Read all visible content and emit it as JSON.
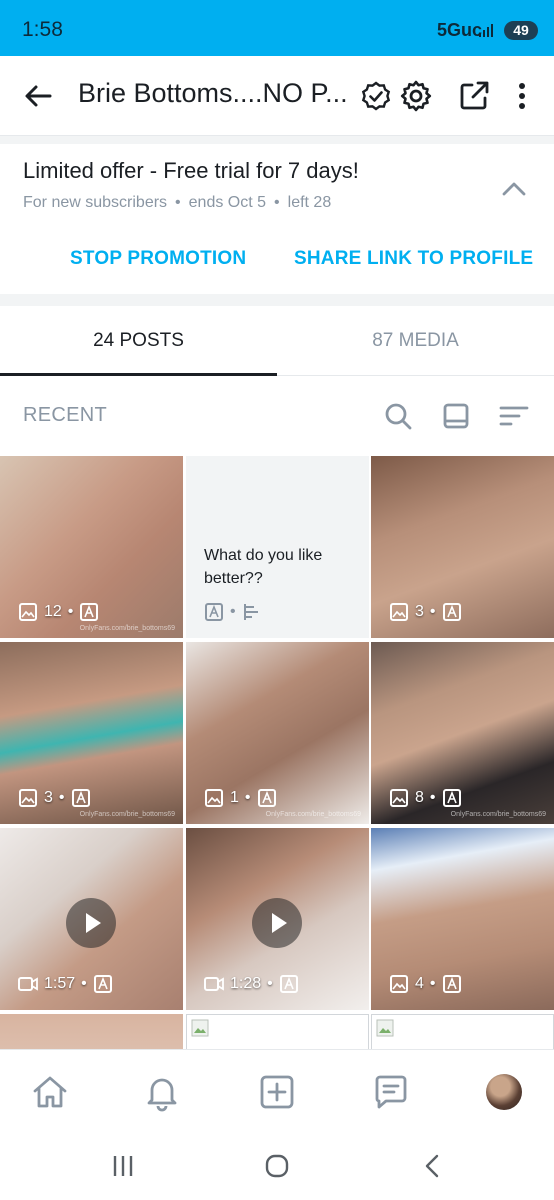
{
  "status": {
    "time": "1:58",
    "network": "5Guc",
    "battery": "49"
  },
  "header": {
    "title": "Brie Bottoms....NO P...",
    "icons": [
      "back-arrow-icon",
      "verified-badge-icon",
      "gear-icon",
      "share-icon",
      "more-vert-icon"
    ]
  },
  "promo": {
    "title": "Limited offer - Free trial for 7 days!",
    "audience": "For new subscribers",
    "ends": "ends Oct 5",
    "left": "left 28",
    "separator": "•",
    "stop_label": "STOP PROMOTION",
    "share_label": "SHARE LINK TO PROFILE"
  },
  "tabs": [
    {
      "label": "24 POSTS",
      "active": true
    },
    {
      "label": "87 MEDIA",
      "active": false
    }
  ],
  "filter": {
    "label": "RECENT",
    "icons": [
      "search-icon",
      "layout-icon",
      "sort-icon"
    ]
  },
  "grid": {
    "tiles": [
      {
        "kind": "photo",
        "count": "12"
      },
      {
        "kind": "text",
        "text": "What do you like better??"
      },
      {
        "kind": "photo",
        "count": "3"
      },
      {
        "kind": "photo",
        "count": "3"
      },
      {
        "kind": "photo",
        "count": "1"
      },
      {
        "kind": "photo",
        "count": "8"
      },
      {
        "kind": "video",
        "duration": "1:57"
      },
      {
        "kind": "video",
        "duration": "1:28"
      },
      {
        "kind": "photo",
        "count": "4"
      }
    ],
    "separator": "•",
    "watermark": "OnlyFans.com/brie_bottoms69"
  },
  "bottom_nav": [
    "home-icon",
    "notifications-icon",
    "add-post-icon",
    "messages-icon",
    "profile-avatar"
  ],
  "colors": {
    "accent": "#00aff0",
    "muted": "#8a96a3",
    "text": "#1b1f24"
  }
}
